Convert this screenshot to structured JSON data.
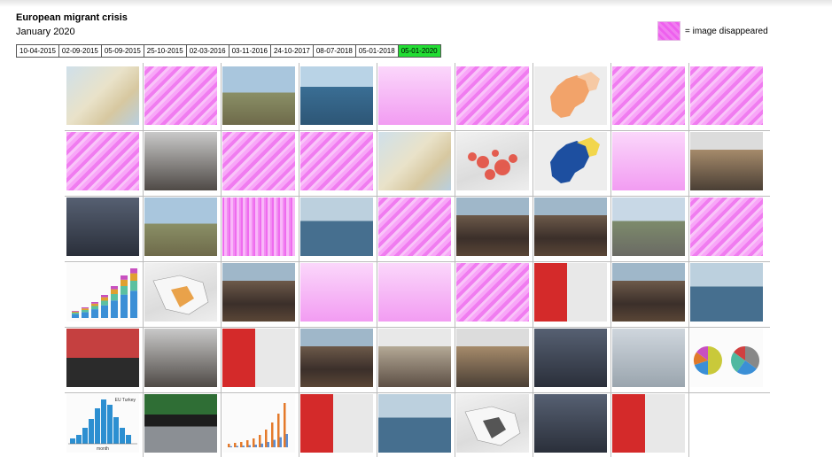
{
  "header": {
    "title": "European migrant crisis",
    "subtitle": "January 2020",
    "legend_label": "= image disappeared"
  },
  "tabs": [
    {
      "label": "10-04-2015",
      "active": false
    },
    {
      "label": "02-09-2015",
      "active": false
    },
    {
      "label": "05-09-2015",
      "active": false
    },
    {
      "label": "25-10-2015",
      "active": false
    },
    {
      "label": "02-03-2016",
      "active": false
    },
    {
      "label": "03-11-2016",
      "active": false
    },
    {
      "label": "24-10-2017",
      "active": false
    },
    {
      "label": "08-07-2018",
      "active": false
    },
    {
      "label": "05-01-2018",
      "active": false
    },
    {
      "label": "05-01-2020",
      "active": true
    }
  ],
  "colors": {
    "active_tab": "#22dd33",
    "disappeared_tint": "#f07cf0",
    "grid_line": "#bbbbbb"
  },
  "grid": {
    "rows": [
      [
        "map-aegean",
        "disappeared",
        "fence-photo",
        "boat-crowd",
        "disappeared-map",
        "disappeared",
        "europe-map",
        "disappeared",
        "disappeared"
      ],
      [
        "disappeared",
        "station-crowd",
        "disappeared",
        "disappeared",
        "map-greece-turkey",
        "europe-bubble-map",
        "eu-blue-map",
        "disappeared-map",
        "camp-crowd"
      ],
      [
        "night-crowd",
        "fence-photo",
        "disappeared-sign",
        "sea-boat",
        "disappeared",
        "crowd-protest",
        "crowd-protest",
        "road-crowd",
        "disappeared"
      ],
      [
        "bar-chart",
        "middle-east-map",
        "crowd-protest",
        "disappeared-map",
        "disappeared-map",
        "disappeared",
        "flag-protest",
        "crowd-protest",
        "sea-boat"
      ],
      [
        "red-crowd",
        "station-crowd",
        "flag-protest",
        "crowd-protest",
        "tent-crowd",
        "camp-crowd",
        "speaker-portrait",
        "gray-sea",
        "pie-charts"
      ],
      [
        "histogram",
        "train-police",
        "line-chart",
        "politician-portrait",
        "sea-boat",
        "gray-map",
        "night-crowd",
        "politician-portrait"
      ]
    ],
    "captions": {
      "histogram": "month",
      "histogram_note": "EU Turkey"
    }
  }
}
